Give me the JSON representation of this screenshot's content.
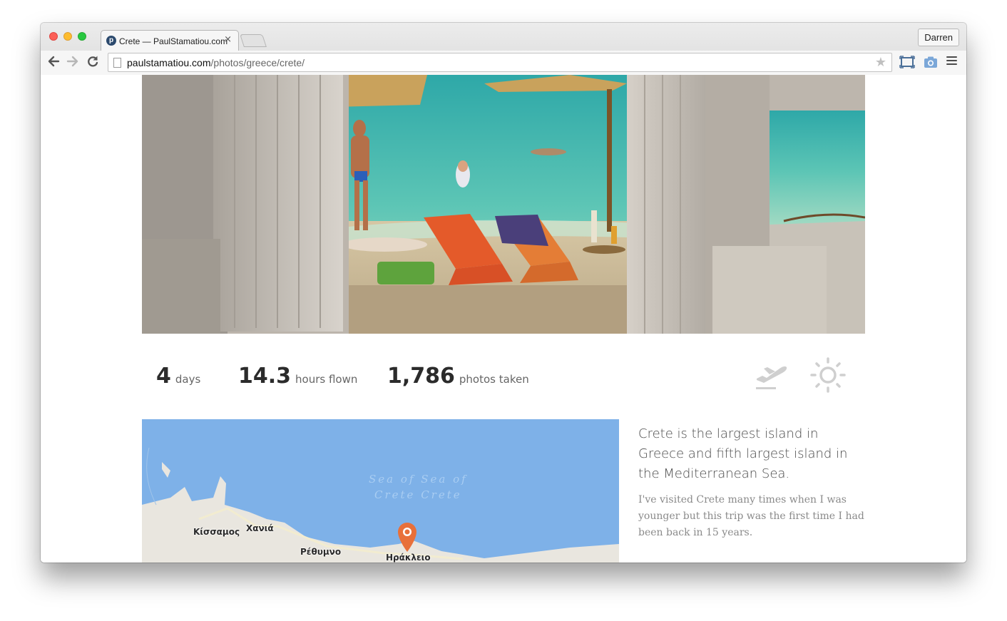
{
  "browser": {
    "tab_title": "Crete — PaulStamatiou.com",
    "tab_favicon_letter": "p",
    "tab_close": "×",
    "profile_name": "Darren",
    "url_host": "paulstamatiou.com",
    "url_path": "/photos/greece/crete/",
    "icons": [
      "back-arrow-icon",
      "forward-arrow-icon",
      "reload-icon",
      "page-icon",
      "bookmark-star-icon",
      "screenshot-extension-icon",
      "camera-extension-icon",
      "menu-icon"
    ]
  },
  "stats": [
    {
      "value": "4",
      "label": "days"
    },
    {
      "value": "14.3",
      "label": "hours flown"
    },
    {
      "value": "1,786",
      "label": "photos taken"
    }
  ],
  "stat_icons": [
    "airplane-takeoff-icon",
    "sun-icon"
  ],
  "map": {
    "sea_label_1": "Sea of Sea of",
    "sea_label_2": "Crete    Crete",
    "places": [
      "Κίσσαμος",
      "Χανιά",
      "Ρέθυμνο",
      "Ηράκλειο"
    ],
    "marker": "map-pin-icon",
    "colors": {
      "water": "#7eb1e8",
      "land": "#e9e6df",
      "marker": "#e8703a"
    }
  },
  "article": {
    "intro": "Crete is the largest island in Greece and fifth largest island in the Mediterranean Sea.",
    "body": "I've visited Crete many times when I was younger but this trip was the first time I had been back in 15 years."
  }
}
